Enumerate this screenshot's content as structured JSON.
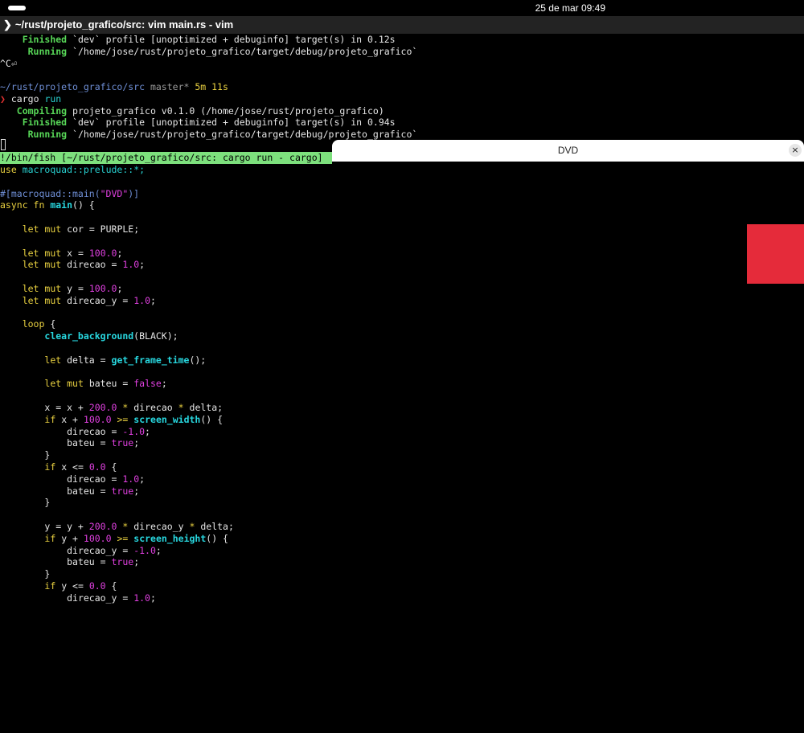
{
  "status_bar": {
    "datetime": "25 de mar  09:49"
  },
  "titlebar": {
    "chevron": "❯",
    "title": "~/rust/projeto_grafico/src: vim main.rs - vim"
  },
  "terminal": {
    "l1_status": "Finished",
    "l1_rest": "`dev` profile [unoptimized + debuginfo] target(s) in 0.12s",
    "l2_status": "Running",
    "l2_rest": "`/home/jose/rust/projeto_grafico/target/debug/projeto_grafico`",
    "l3": "^C⏎",
    "prompt_path": "~/rust/projeto_grafico/src",
    "prompt_branch": "master*",
    "prompt_time": "5m 11s",
    "prompt_symbol": "❯",
    "cmd": "cargo",
    "cmd_arg": "run",
    "l6_status": "Compiling",
    "l6_rest": "projeto_grafico v0.1.0 (/home/jose/rust/projeto_grafico)",
    "l7_status": "Finished",
    "l7_rest": "`dev` profile [unoptimized + debuginfo] target(s) in 0.94s",
    "l8_status": "Running",
    "l8_rest": "`/home/jose/rust/projeto_grafico/target/debug/projeto_grafico`"
  },
  "vim_status": "!/bin/fish [~/rust/projeto_grafico/src: cargo run - cargo]",
  "code": {
    "use": "use",
    "use_rest": "macroquad::prelude::*;",
    "attr": "#[macroquad::main(",
    "attr_str": "\"DVD\"",
    "attr_end": ")]",
    "async_fn": "async fn",
    "main": "main",
    "main_rest": "() {",
    "let": "let",
    "mut": "mut",
    "cor": "cor = PURPLE;",
    "x": "x =",
    "x_val": "100.0",
    "direcao": "direcao =",
    "one": "1.0",
    "y": "y =",
    "direcao_y": "direcao_y =",
    "loop": "loop",
    "brace_open": "{",
    "clear_background": "clear_background",
    "clear_arg": "(BLACK);",
    "delta": "delta =",
    "get_frame_time": "get_frame_time",
    "call_end": "();",
    "bateu": "bateu =",
    "false": "false",
    "true": "true",
    "x_eq": "x = x +",
    "two_hundred": "200.0",
    "star": "*",
    "direcao_word": "direcao",
    "delta_word": "delta;",
    "if": "if",
    "x_plus": "x +",
    "ge": ">=",
    "screen_width": "screen_width",
    "screen_height": "screen_height",
    "paren_brace": "() {",
    "direcao_eq": "direcao =",
    "neg_one": "-1.0",
    "semicolon": ";",
    "bateu_eq": "bateu =",
    "close": "}",
    "x_le": "x <=",
    "zero": "0.0",
    "y_eq": "y = y +",
    "direcao_y_word": "direcao_y",
    "y_plus": "y +",
    "direcao_y_eq": "direcao_y =",
    "y_le": "y <="
  },
  "dvd_window": {
    "title": "DVD",
    "close_icon": "×",
    "square_color": "#e52b3a"
  }
}
